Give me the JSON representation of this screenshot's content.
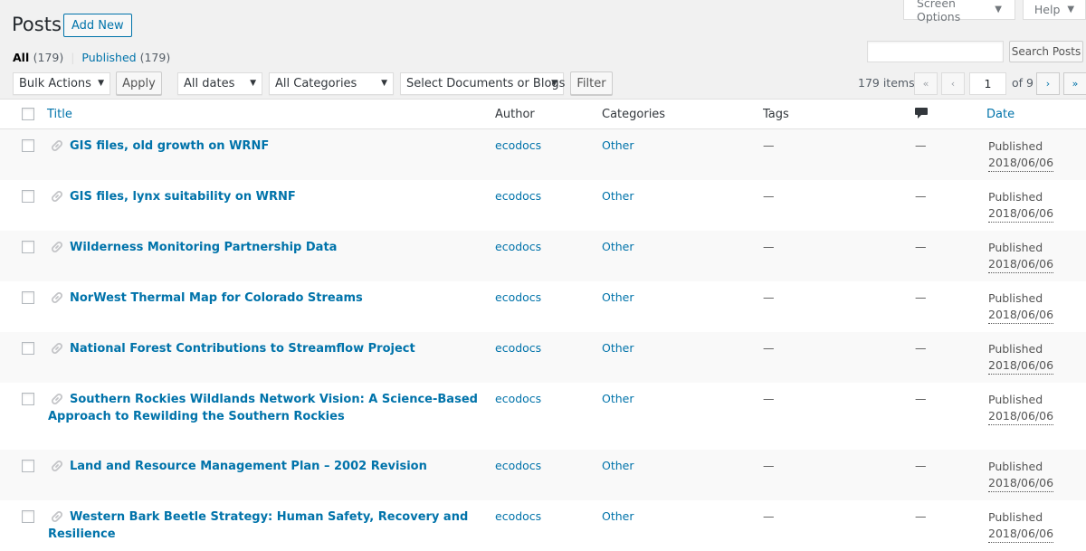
{
  "screen_tabs": {
    "options": "Screen Options",
    "help": "Help"
  },
  "header": {
    "title": "Posts",
    "add_new": "Add New"
  },
  "views": {
    "all_label": "All",
    "all_count": "(179)",
    "separator": "|",
    "published_label": "Published",
    "published_count": "(179)"
  },
  "search": {
    "value": "",
    "button": "Search Posts"
  },
  "filters": {
    "bulk_actions": "Bulk Actions",
    "apply": "Apply",
    "dates": "All dates",
    "categories": "All Categories",
    "doc_type": "Select Documents or Blogs",
    "filter": "Filter"
  },
  "pagination": {
    "items": "179 items",
    "first": "«",
    "prev": "‹",
    "next": "›",
    "last": "»",
    "current": "1",
    "of": "of 9"
  },
  "columns": {
    "title": "Title",
    "author": "Author",
    "categories": "Categories",
    "tags": "Tags",
    "comments_icon": "comment-icon",
    "date": "Date"
  },
  "posts": [
    {
      "title": "GIS files, old growth on WRNF",
      "author": "ecodocs",
      "category": "Other",
      "tags": "—",
      "comments": "—",
      "status": "Published",
      "date": "2018/06/06"
    },
    {
      "title": "GIS files, lynx suitability on WRNF",
      "author": "ecodocs",
      "category": "Other",
      "tags": "—",
      "comments": "—",
      "status": "Published",
      "date": "2018/06/06"
    },
    {
      "title": "Wilderness Monitoring Partnership Data",
      "author": "ecodocs",
      "category": "Other",
      "tags": "—",
      "comments": "—",
      "status": "Published",
      "date": "2018/06/06"
    },
    {
      "title": "NorWest Thermal Map for Colorado Streams",
      "author": "ecodocs",
      "category": "Other",
      "tags": "—",
      "comments": "—",
      "status": "Published",
      "date": "2018/06/06"
    },
    {
      "title": "National Forest Contributions to Streamflow Project",
      "author": "ecodocs",
      "category": "Other",
      "tags": "—",
      "comments": "—",
      "status": "Published",
      "date": "2018/06/06"
    },
    {
      "title": "Southern Rockies Wildlands Network Vision: A Science-Based Approach to Rewilding the Southern Rockies",
      "author": "ecodocs",
      "category": "Other",
      "tags": "—",
      "comments": "—",
      "status": "Published",
      "date": "2018/06/06"
    },
    {
      "title": "Land and Resource Management Plan – 2002 Revision",
      "author": "ecodocs",
      "category": "Other",
      "tags": "—",
      "comments": "—",
      "status": "Published",
      "date": "2018/06/06"
    },
    {
      "title": "Western Bark Beetle Strategy: Human Safety, Recovery and Resilience",
      "author": "ecodocs",
      "category": "Other",
      "tags": "—",
      "comments": "—",
      "status": "Published",
      "date": "2018/06/06"
    }
  ]
}
